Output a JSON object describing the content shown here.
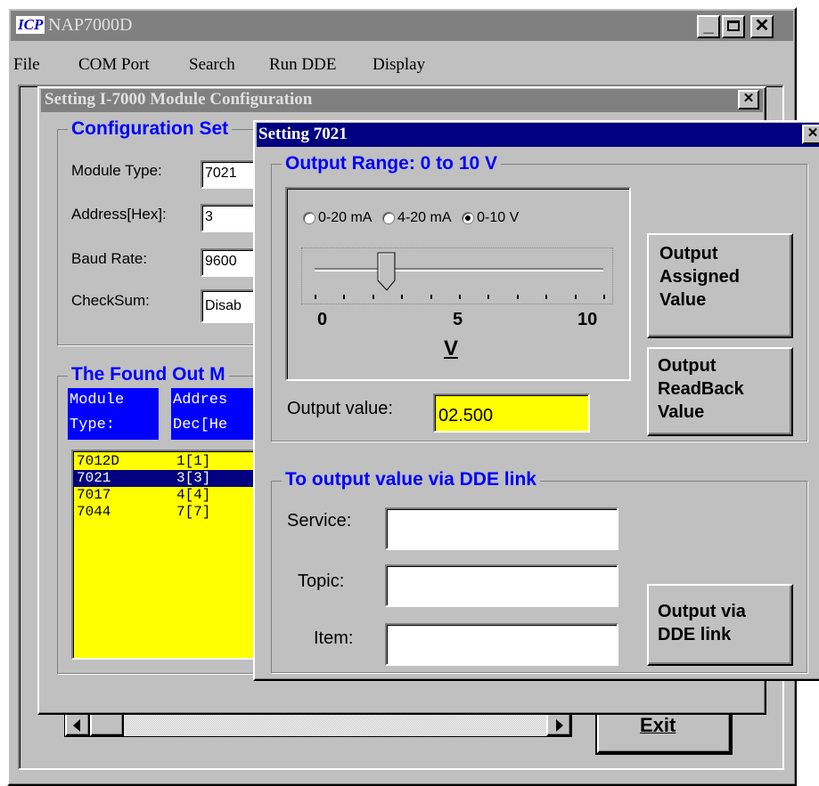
{
  "main_window": {
    "logo_text": "ICP",
    "title": "NAP7000D",
    "menu": [
      "File",
      "COM Port",
      "Search",
      "Run DDE",
      "Display"
    ],
    "exit_label": "Exit"
  },
  "config_dialog": {
    "title": "Setting I-7000 Module Configuration",
    "group_title": "Configuration Set",
    "module_type_label": "Module Type:",
    "module_type_value": "7021",
    "address_label": "Address[Hex]:",
    "address_value": "3",
    "baud_label": "Baud Rate:",
    "baud_value": "9600",
    "checksum_label": "CheckSum:",
    "checksum_value": "Disab",
    "found_title": "The Found Out M",
    "list_header": {
      "col1_line1": "Module",
      "col1_line2": "Type:",
      "col2_line1": "Addres",
      "col2_line2": "Dec[He"
    },
    "modules": [
      {
        "type": "7012D",
        "addr": "1[1]",
        "selected": false
      },
      {
        "type": "7021",
        "addr": "3[3]",
        "selected": true
      },
      {
        "type": "7017",
        "addr": "4[4]",
        "selected": false
      },
      {
        "type": "7044",
        "addr": "7[7]",
        "selected": false
      }
    ]
  },
  "setting_dialog": {
    "title": "Setting 7021",
    "range_group_title": "Output Range: 0 to 10 V",
    "radios": [
      {
        "label": "0-20 mA",
        "checked": false
      },
      {
        "label": "4-20 mA",
        "checked": false
      },
      {
        "label": "0-10 V",
        "checked": true
      }
    ],
    "slider": {
      "min": 0,
      "max": 10,
      "value": 2.5
    },
    "scale_labels": [
      "0",
      "5",
      "10"
    ],
    "unit": "V",
    "output_value_label": "Output value:",
    "output_value": "02.500",
    "btn_assigned": [
      "Output",
      "Assigned",
      "Value"
    ],
    "btn_readback": [
      "Output",
      "ReadBack",
      "Value"
    ],
    "dde_group_title": "To output value via DDE link",
    "service_label": "Service:",
    "topic_label": "Topic:",
    "item_label": "Item:",
    "service_value": "",
    "topic_value": "",
    "item_value": "",
    "btn_dde": [
      "Output via",
      "DDE link"
    ]
  },
  "colors": {
    "face": "#c0c0c0",
    "active_title": "#000080",
    "inactive_title": "#808080",
    "group_title": "#0000ff",
    "list_bg": "#ffff00",
    "highlight": "#000080"
  }
}
